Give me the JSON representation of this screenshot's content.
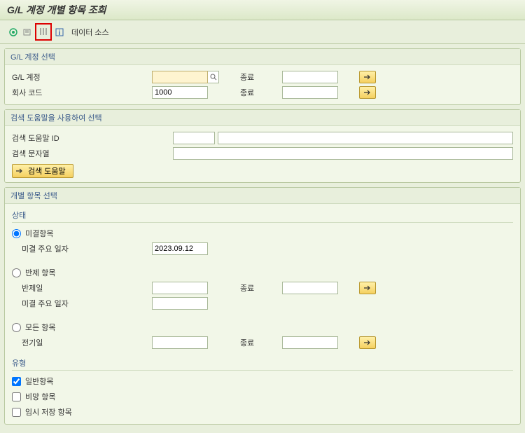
{
  "title": "G/L 계정 개별 항목 조회",
  "toolbar": {
    "data_source": "데이터 소스"
  },
  "panel1": {
    "title": "G/L 계정 선택",
    "gl_label": "G/L 계정",
    "gl_value": "",
    "company_label": "회사 코드",
    "company_value": "1000",
    "end_label": "종료"
  },
  "panel2": {
    "title": "검색 도움말을 사용하여 선택",
    "id_label": "검색 도움말 ID",
    "id_value": "",
    "str_label": "검색 문자열",
    "str_value": "",
    "btn_label": "검색 도움말"
  },
  "panel3": {
    "title": "개별 항목 선택",
    "status_title": "상태",
    "open_label": "미결항목",
    "open_date_label": "미결 주요 일자",
    "open_date_value": "2023.09.12",
    "clear_label": "반제 항목",
    "clear_date_label": "반제일",
    "clear_date2_label": "미결 주요 일자",
    "all_label": "모든 항목",
    "posting_label": "전기일",
    "end_label": "종료",
    "type_title": "유형",
    "normal_label": "일반항목",
    "noted_label": "비망 항목",
    "parked_label": "임시 저장 항목"
  }
}
